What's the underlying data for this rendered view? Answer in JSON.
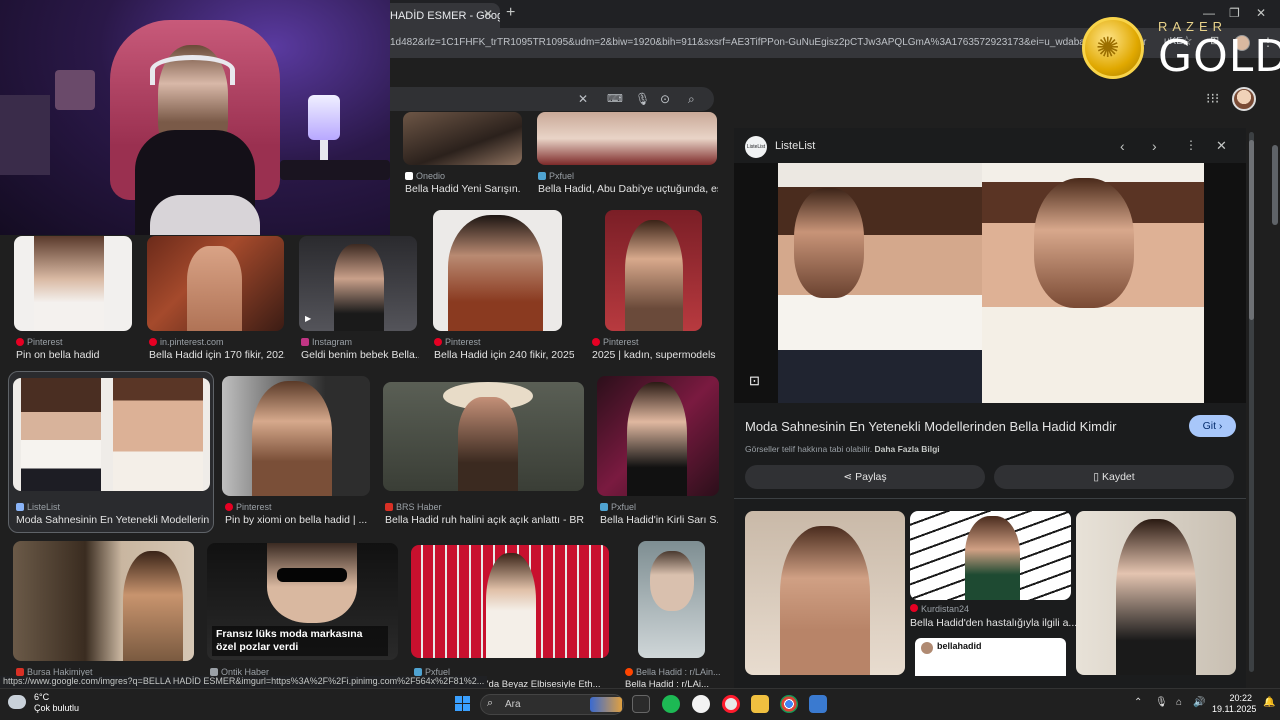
{
  "browser": {
    "tab_title": "HADİD ESMER - Google",
    "url_fragment": "1d482&rlz=1C1FHFK_trTR1095TR1095&udm=2&biw=1920&bih=911&sxsrf=AE3TifPPon-GuNuEgisz2pCTJw3APQLGmA%3A1763572923173&ei=u_wdabajCqKjwPAPl7r",
    "url_tail": "uKE"
  },
  "grid": {
    "row0": [
      {
        "source": "Onedio",
        "title": "Bella Hadid Yeni Sarışın..."
      },
      {
        "source": "Pxfuel",
        "title": "Bella Hadid, Abu Dabi'ye uçtuğunda, es..."
      }
    ],
    "row1": [
      {
        "source": "Pinterest",
        "title": "Pin on bella hadid"
      },
      {
        "source": "in.pinterest.com",
        "title": "Bella Hadid için 170 fikir, 202..."
      },
      {
        "source": "Instagram",
        "title": "Geldi benim bebek Bella..."
      },
      {
        "source": "Pinterest",
        "title": "Bella Hadid için 240 fikir, 2025..."
      },
      {
        "source": "Pinterest",
        "title": "2025 | kadın, supermodels..."
      }
    ],
    "row2": [
      {
        "source": "ListeList",
        "title": "Moda Sahnesinin En Yetenekli Modellerin..."
      },
      {
        "source": "Pinterest",
        "title": "Pin by xiomi on bella hadid | ..."
      },
      {
        "source": "BRS Haber",
        "title": "Bella Hadid ruh halini açık açık anlattı - BR..."
      },
      {
        "source": "Pxfuel",
        "title": "Bella Hadid'in Kirli Sarı S..."
      }
    ],
    "row3": [
      {
        "source": "Bursa Hakimiyet",
        "title": ""
      },
      {
        "source": "Ontik Haber",
        "title": ""
      },
      {
        "source": "Pxfuel",
        "title": "lla Hadid 2019'da Beyaz Elbisesiyle Eth..."
      },
      {
        "source": "Bella Hadid : r/LAin...",
        "title": "Bella Hadid : r/LAi..."
      }
    ],
    "overlay_caption": "Fransız lüks moda markasına özel pozlar verdi"
  },
  "panel": {
    "favicon_text": "ListeList",
    "source": "ListeList",
    "title": "Moda Sahnesinin En Yetenekli Modellerinden Bella Hadid Kimdir",
    "visit_label": "Git",
    "copyright": "Görseller telif hakkına tabi olabilir.",
    "more_info": "Daha Fazla Bilgi",
    "share_label": "Paylaş",
    "save_label": "Kaydet",
    "related_source": "Kurdistan24",
    "related_title": "Bella Hadid'den hastalığıyla ilgili a...",
    "related_handle": "bellahadid"
  },
  "overlay": {
    "razer_label": "RAZER",
    "gold_label": "GOLD"
  },
  "status_url": "https://www.google.com/imgres?q=BELLA HADİD ESMER&imgurl=https%3A%2F%2Fi.pinimg.com%2F564x%2F81%2...",
  "taskbar": {
    "temperature": "6°C",
    "weather": "Çok bulutlu",
    "search_label": "Ara",
    "time": "20:22",
    "date": "19.11.2025"
  },
  "colors": {
    "accent_button": "#a8c7fa",
    "background": "#1f1f1f",
    "pinterest": "#e60023"
  }
}
